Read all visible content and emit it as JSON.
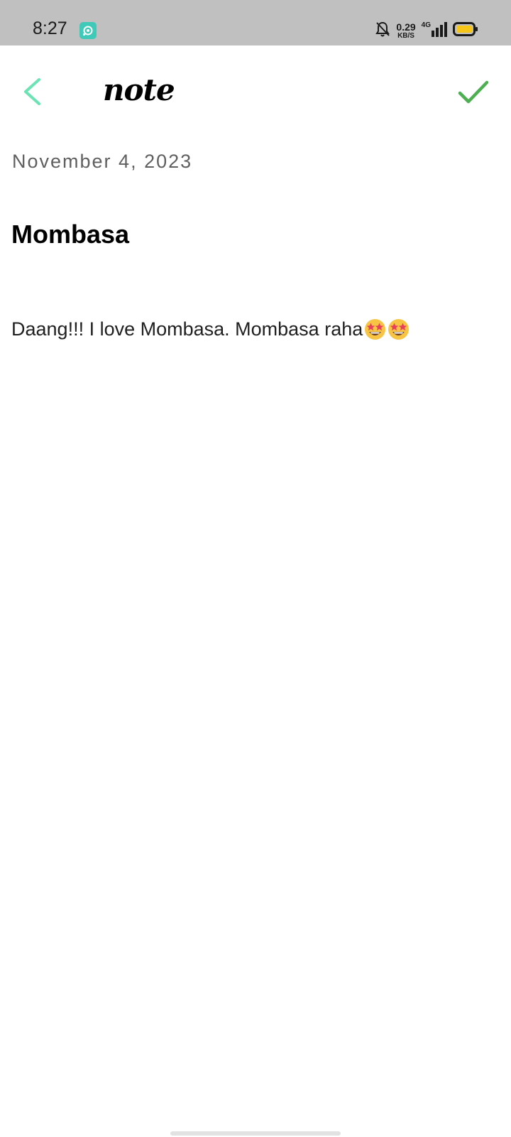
{
  "status_bar": {
    "time": "8:27",
    "speed_value": "0.29",
    "speed_unit": "KB/S",
    "network": "4G",
    "app_icon": "camera-app-icon",
    "mute_icon": "bell-off-icon",
    "signal_icon": "signal-icon",
    "battery_icon": "battery-icon",
    "background": "#c0c0c0"
  },
  "toolbar": {
    "title": "note",
    "back_icon": "chevron-left-icon",
    "back_color": "#6be3b5",
    "save_icon": "checkmark-icon",
    "save_color": "#4caf50"
  },
  "note": {
    "date": "November 4, 2023",
    "title": "Mombasa",
    "body_text": "Daang!!! I love Mombasa. Mombasa raha",
    "body_emojis": [
      "star-struck-emoji",
      "star-struck-emoji"
    ]
  }
}
